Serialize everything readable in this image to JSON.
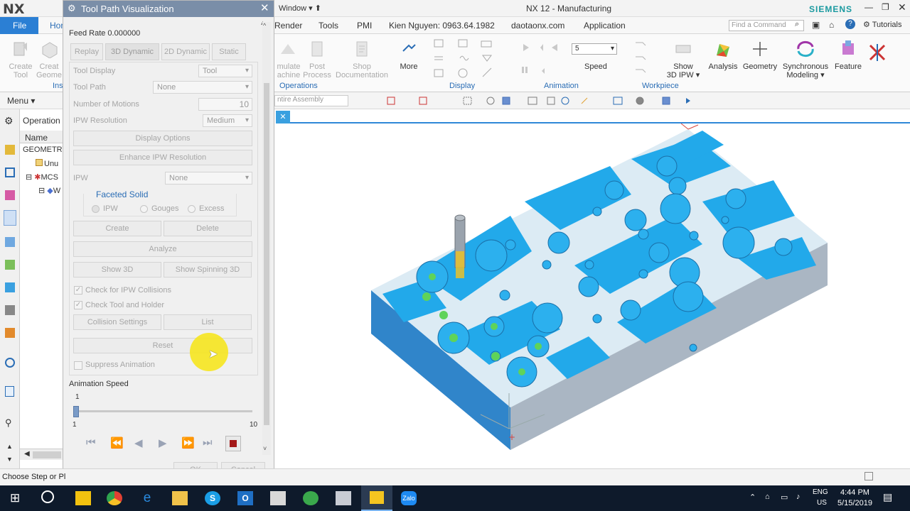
{
  "app": {
    "logo": "NX",
    "window_title": "NX 12 - Manufacturing",
    "brand": "SIEMENS",
    "window_menu": "Window ▾ ⬆"
  },
  "menubar": {
    "file": "File",
    "home": "Hor",
    "render": "Render",
    "tools": "Tools",
    "pmi": "PMI",
    "author": "Kien Nguyen: 0963.64.1982",
    "site": "daotaonx.com",
    "application": "Application",
    "find_placeholder": "Find a Command",
    "tutorials": "Tutorials"
  },
  "ribbon": {
    "create_tool": "Create\nTool",
    "create_geom": "Creat\nGeome",
    "ins": "Ins",
    "simulate": "mulate\nachine",
    "post_process": "Post\nProcess",
    "shop_doc": "Shop\nDocumentation",
    "more": "More",
    "speed_value": "5",
    "speed": "Speed",
    "show_ipw": "Show\n3D IPW ▾",
    "analysis": "Analysis",
    "geometry": "Geometry",
    "sync": "Synchronous\nModeling ▾",
    "feature": "Feature",
    "groups": {
      "operations": "Operations",
      "display": "Display",
      "animation": "Animation",
      "workpiece": "Workpiece"
    }
  },
  "toolbar2": {
    "menu": "Menu ▾",
    "assembly": "ntire Assembly"
  },
  "navigator": {
    "title": "Operation N",
    "name_col": "Name",
    "items": [
      "GEOMETRY",
      "Unu",
      "MCS",
      "W"
    ]
  },
  "dialog": {
    "title": "Tool Path Visualization",
    "feed_rate": "Feed Rate 0.000000",
    "tabs": [
      "Replay",
      "3D Dynamic",
      "2D Dynamic",
      "Static"
    ],
    "tool_display_label": "Tool Display",
    "tool_display_value": "Tool",
    "tool_path_label": "Tool Path",
    "tool_path_value": "None",
    "motions_label": "Number of Motions",
    "motions_value": "10",
    "ipw_res_label": "IPW Resolution",
    "ipw_res_value": "Medium",
    "display_options": "Display Options",
    "enhance_ipw": "Enhance IPW Resolution",
    "ipw_label": "IPW",
    "ipw_value": "None",
    "faceted_solid": "Faceted Solid",
    "radio_ipw": "IPW",
    "radio_gouges": "Gouges",
    "radio_excess": "Excess",
    "create": "Create",
    "delete": "Delete",
    "analyze": "Analyze",
    "show_3d": "Show 3D",
    "show_spinning": "Show Spinning 3D",
    "check_ipw": "Check for IPW Collisions",
    "check_tool": "Check Tool and Holder",
    "collision_settings": "Collision Settings",
    "list": "List",
    "reset": "Reset",
    "suppress": "Suppress Animation",
    "anim_speed_label": "Animation Speed",
    "slider_value": "1",
    "slider_min": "1",
    "slider_max": "10",
    "ok": "OK",
    "cancel": "Cancel"
  },
  "status": {
    "text": "Choose Step or Pl"
  },
  "taskbar": {
    "lang": "ENG",
    "region": "US",
    "time": "4:44 PM",
    "date": "5/15/2019"
  },
  "colors": {
    "accent": "#2a6db5",
    "dialog_title": "#7a8ea8",
    "workpiece": "#2ba7e6",
    "file_tab": "#2b7fd4"
  }
}
